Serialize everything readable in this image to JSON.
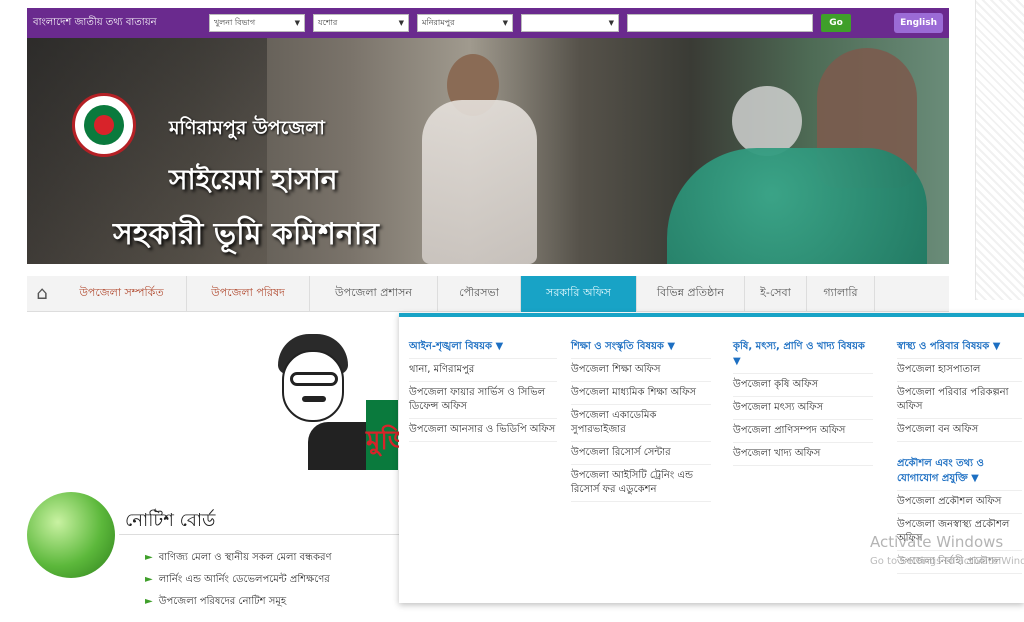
{
  "topbar": {
    "site_name": "বাংলাদেশ জাতীয় তথ্য বাতায়ন",
    "selects": [
      "খুলনা বিভাগ",
      "যশোর",
      "মনিরামপুর",
      ""
    ],
    "go_label": "Go",
    "english_label": "English"
  },
  "banner": {
    "upazila": "মণিরামপুর উপজেলা",
    "officer": "সাইয়েমা হাসান",
    "role": "সহকারী ভূমি কমিশনার"
  },
  "menu": {
    "items": [
      "উপজেলা সম্পর্কিত",
      "উপজেলা পরিষদ",
      "উপজেলা প্রশাসন",
      "পৌরসভা",
      "সরকারি অফিস",
      "বিভিন্ন প্রতিষ্ঠান",
      "ই-সেবা",
      "গ্যালারি"
    ]
  },
  "dropdown": {
    "col1": {
      "heading": "আইন-শৃঙ্খলা বিষয়ক ▼",
      "links": [
        "থানা, মণিরামপুর",
        "উপজেলা ফায়ার সার্ভিস ও সিভিল ডিফেন্স অফিস",
        "উপজেলা আনসার ও ভিডিপি অফিস"
      ]
    },
    "col2": {
      "heading": "শিক্ষা ও সংস্কৃতি বিষয়ক ▼",
      "links": [
        "উপজেলা শিক্ষা অফিস",
        "উপজেলা মাধ্যমিক শিক্ষা অফিস",
        "উপজেলা একাডেমিক সুপারভাইজার",
        "উপজেলা রিসোর্স সেন্টার",
        "উপজেলা আইসিটি ট্রেনিং এন্ড রিসোর্স ফর এডুকেশন"
      ]
    },
    "col3": {
      "heading": "কৃষি, মৎস্য, প্রাণি ও খাদ্য বিষয়ক ▼",
      "links": [
        "উপজেলা কৃষি অফিস",
        "উপজেলা মৎস্য অফিস",
        "উপজেলা প্রাণিসম্পদ অফিস",
        "উপজেলা খাদ্য অফিস"
      ]
    },
    "col4": {
      "heading": "স্বাস্থ্য ও পরিবার বিষয়ক ▼",
      "links": [
        "উপজেলা হাসপাতাল",
        "উপজেলা পরিবার পরিকল্পনা অফিস",
        "উপজেলা বন অফিস"
      ],
      "heading2": "প্রকৌশল এবং তথ্য ও যোগাযোগ প্রযুক্তি ▼",
      "links2": [
        "উপজেলা প্রকৌশল অফিস",
        "উপজেলা জনস্বাস্থ্য প্রকৌশল অফিস",
        "উপজেলা নির্বাহী প্রকৌশল"
      ]
    }
  },
  "watermark": {
    "line1": "Activate Windows",
    "line2": "Go to Settings to activate Windows."
  },
  "portrait_text": "মুজি",
  "notice": {
    "title": "নোটিশ বোর্ড",
    "items": [
      "বাণিজ্য মেলা ও স্থানীয় সকল মেলা বন্ধকরণ",
      "লার্নিং এন্ড আর্নিং ডেভেলপমেন্ট প্রশিক্ষণের",
      "উপজেলা পরিষদের নোটিশ সমূহ"
    ]
  },
  "colors": {
    "topbar": "#6a2a8e",
    "menu_active": "#18a3c6",
    "menu_text": "#b0472c",
    "link": "#1d6fc2",
    "go_button": "#3f9f2a"
  }
}
